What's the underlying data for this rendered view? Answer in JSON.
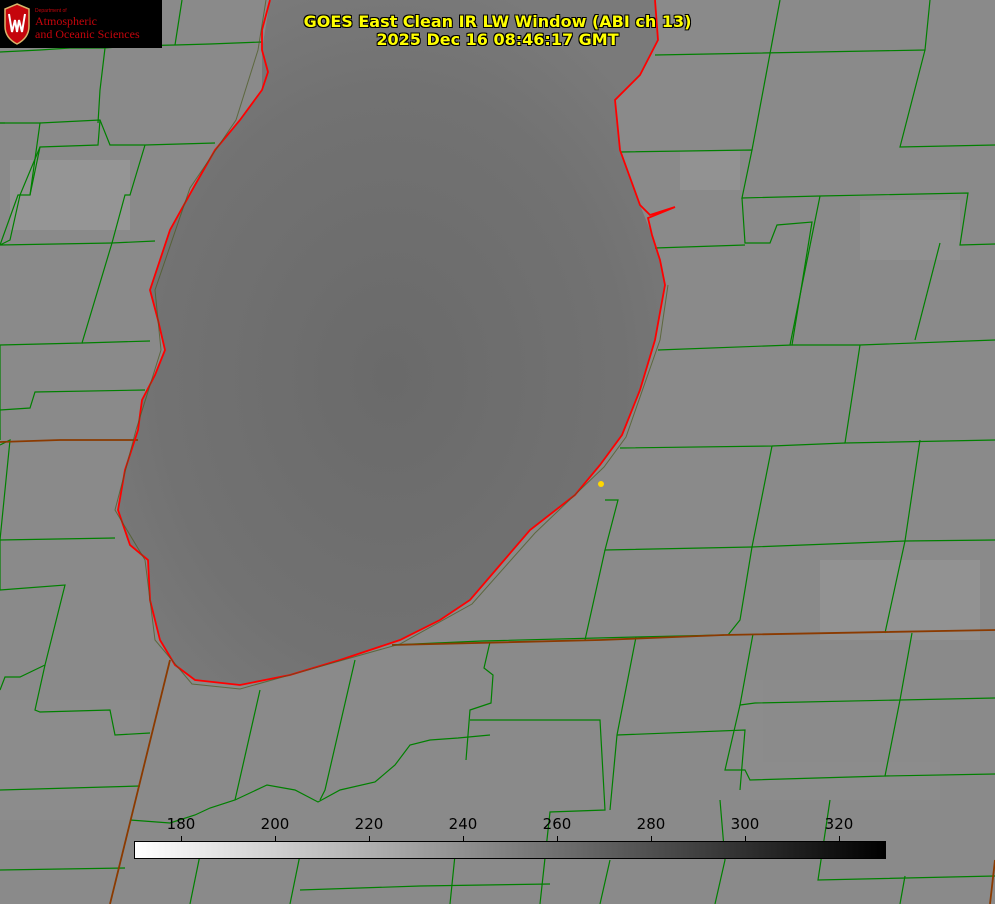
{
  "title": {
    "line1": "GOES East Clean IR LW Window (ABI ch 13)",
    "line2": "2025 Dec 16 08:46:17 GMT"
  },
  "logo": {
    "icon": "uw-crest-icon",
    "department": "Department of",
    "line1": "Atmospheric",
    "line2": "and Oceanic Sciences"
  },
  "colorbar": {
    "min": 170,
    "max": 330,
    "ticks": [
      "180",
      "200",
      "220",
      "240",
      "260",
      "280",
      "300",
      "320"
    ],
    "gradient": [
      "#ffffff",
      "#000000"
    ]
  },
  "colors": {
    "background": "#8a8a8a",
    "lake": "#6e6e6e",
    "county_lines": "#008000",
    "coastline": "#ff0000",
    "state_lines": "#8b3a00",
    "title": "#ffff00",
    "point_marker": "#ffd700"
  }
}
